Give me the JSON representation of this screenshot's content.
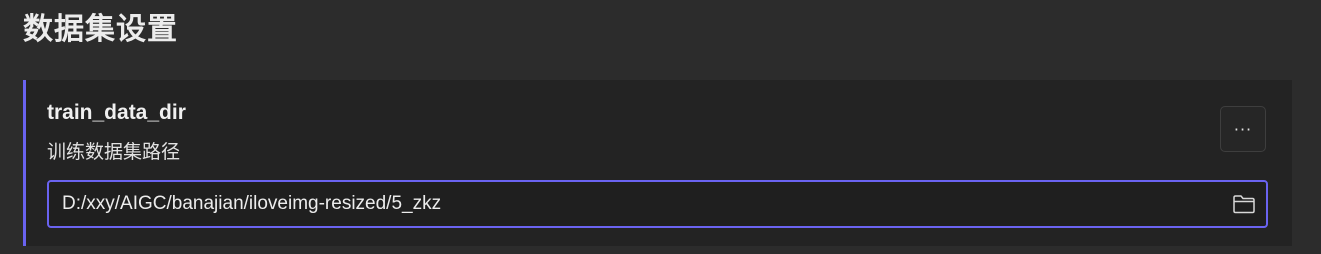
{
  "section": {
    "title": "数据集设置"
  },
  "setting": {
    "name": "train_data_dir",
    "description": "训练数据集路径",
    "more_label": "···",
    "value": "D:/xxy/AIGC/banajian/iloveimg-resized/5_zkz",
    "browse_icon": "folder-icon"
  },
  "colors": {
    "accent": "#6a63f0",
    "page_background": "#2c2c2c",
    "card_background": "#232323"
  }
}
